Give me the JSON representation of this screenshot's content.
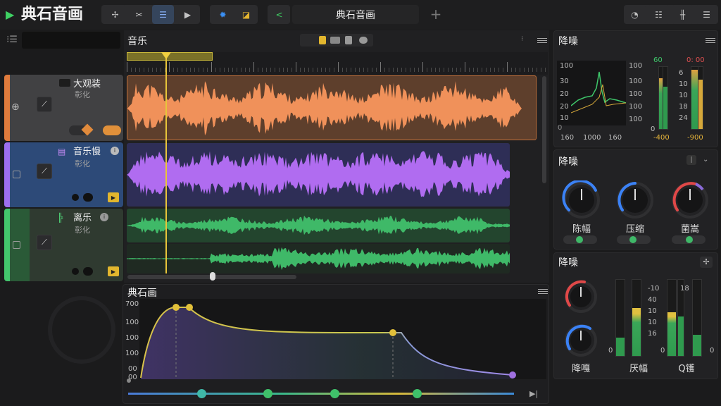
{
  "app": {
    "title": "典石音画",
    "track_name_display": "典石音画",
    "add_label": "+"
  },
  "toolbar": {
    "group1": [
      "arrows-icon",
      "scissors-icon",
      "list-icon",
      "play-icon"
    ],
    "group2": [
      "gear-icon",
      "folder-icon"
    ],
    "group3": [
      "back-icon",
      "levels-icon"
    ],
    "right": [
      "clock-icon",
      "sliders-icon",
      "mixer-icon",
      "settings-icon"
    ]
  },
  "arrange": {
    "title": "音乐",
    "tool_icons": [
      "lock-icon",
      "box-icon",
      "bar-icon",
      "disc-icon"
    ]
  },
  "tracks": [
    {
      "name": "大观装",
      "sub": "彰化",
      "color": "#e07b3c",
      "icon": "波"
    },
    {
      "name": "音乐慢",
      "sub": "彰化",
      "color": "#9d6ff0",
      "icon": "波"
    },
    {
      "name": "离乐",
      "sub": "彰化",
      "color": "#43c56d",
      "icon": "波"
    }
  ],
  "automation": {
    "title": "典石画",
    "y_ticks": [
      "700",
      "100",
      "100",
      "100",
      "00",
      "00"
    ]
  },
  "right_panel": {
    "spectrum": {
      "title": "降噪",
      "y_left": [
        "100",
        "30",
        "20",
        "20",
        "10",
        "0"
      ],
      "y_right": [
        "100",
        "100",
        "100",
        "100",
        "100"
      ],
      "x_ticks": [
        "160",
        "1000",
        "160"
      ],
      "meter_tops": [
        "60",
        "0: 00"
      ],
      "meter_scale": [
        "6",
        "10",
        "10",
        "18",
        "24",
        "0"
      ],
      "meter_bottoms": [
        "-400",
        "-900"
      ]
    },
    "knobs1": {
      "title": "降噪",
      "items": [
        {
          "label": "陈幅",
          "color": "#3b82f6"
        },
        {
          "label": "压缩",
          "color": "#3b82f6"
        },
        {
          "label": "菌嵩",
          "color": "#e04848"
        }
      ]
    },
    "knobs2": {
      "title": "降噪",
      "items": [
        {
          "label": "降嘎",
          "color": "#e04848"
        },
        {
          "label": "",
          "color": "#3b82f6"
        }
      ],
      "meter_labels": [
        "0",
        "0",
        "0"
      ],
      "meter_scale": [
        "-10",
        "40",
        "10",
        "10",
        "16",
        "18"
      ],
      "bottom_labels": [
        "厌幅",
        "Q镬"
      ]
    }
  }
}
